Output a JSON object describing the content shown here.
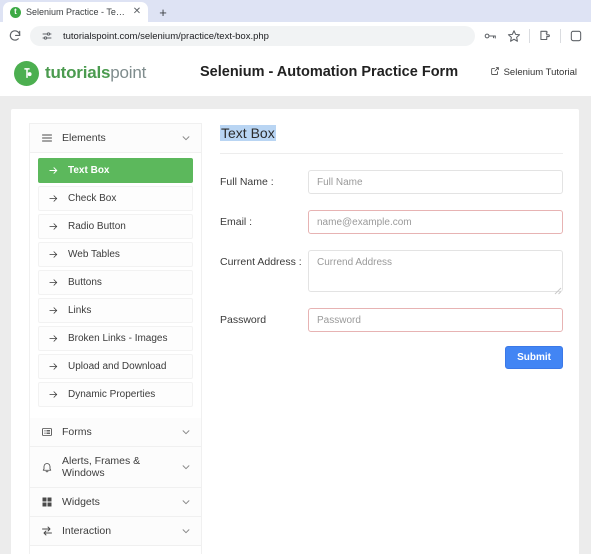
{
  "browser": {
    "tab": {
      "title": "Selenium Practice - Text Box",
      "favicon_letter": "t",
      "close_glyph": "✕"
    },
    "new_tab_glyph": "+",
    "omnibox": {
      "url": "tutorialspoint.com/selenium/practice/text-box.php"
    },
    "icons": {
      "reload": "reload-icon",
      "site_settings": "tune-icon",
      "password_key": "key-icon",
      "bookmark_star": "star-icon",
      "extensions": "puzzle-icon",
      "profile": "profile-icon"
    }
  },
  "site": {
    "brand": {
      "first": "tutorials",
      "second": "point"
    },
    "title": "Selenium - Automation Practice Form",
    "tutorial_link": "Selenium Tutorial"
  },
  "sidebar": {
    "sections": [
      {
        "label": "Elements",
        "icon": "hamburger-icon",
        "expanded": true,
        "items": [
          {
            "label": "Text Box",
            "active": true
          },
          {
            "label": "Check Box",
            "active": false
          },
          {
            "label": "Radio Button",
            "active": false
          },
          {
            "label": "Web Tables",
            "active": false
          },
          {
            "label": "Buttons",
            "active": false
          },
          {
            "label": "Links",
            "active": false
          },
          {
            "label": "Broken Links - Images",
            "active": false
          },
          {
            "label": "Upload and Download",
            "active": false
          },
          {
            "label": "Dynamic Properties",
            "active": false
          }
        ]
      },
      {
        "label": "Forms",
        "icon": "list-icon",
        "expanded": false
      },
      {
        "label": "Alerts, Frames & Windows",
        "icon": "bell-icon",
        "expanded": false
      },
      {
        "label": "Widgets",
        "icon": "grid-icon",
        "expanded": false
      },
      {
        "label": "Interaction",
        "icon": "arrows-icon",
        "expanded": false
      }
    ]
  },
  "form": {
    "heading": "Text Box",
    "fields": [
      {
        "label": "Full Name :",
        "placeholder": "Full Name",
        "value": "",
        "invalid": false
      },
      {
        "label": "Email :",
        "placeholder": "name@example.com",
        "value": "",
        "invalid": true
      },
      {
        "label": "Current Address :",
        "placeholder": "Currend Address",
        "value": "",
        "invalid": false
      },
      {
        "label": "Password",
        "placeholder": "Password",
        "value": "",
        "invalid": true
      }
    ],
    "submit_label": "Submit"
  },
  "colors": {
    "brand_green": "#4b9b4f",
    "active_green": "#5cb85c",
    "submit_blue": "#4285f4",
    "invalid_border": "#e7b3b3",
    "selection_blue": "#b9d5f3",
    "page_bg": "#ececec"
  }
}
